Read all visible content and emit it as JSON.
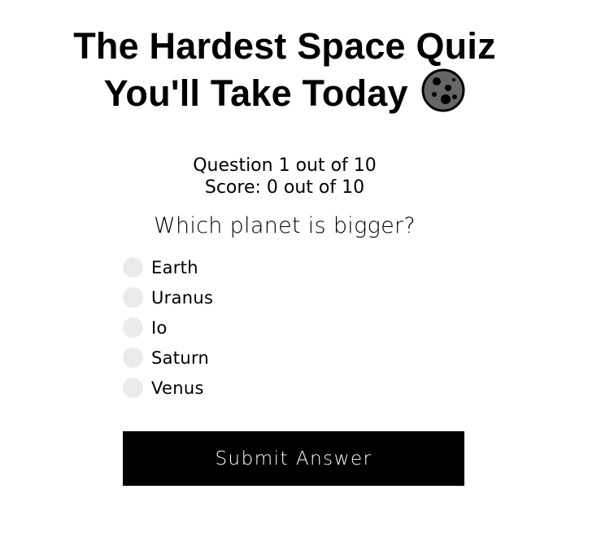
{
  "header": {
    "title_line1": "The Hardest Space Quiz",
    "title_line2": "You'll Take Today",
    "moon_icon": "moon-icon"
  },
  "progress": {
    "question_text": "Question 1 out of 10",
    "score_text": "Score: 0 out of 10"
  },
  "quiz": {
    "question": "Which planet is bigger?",
    "options": [
      {
        "label": "Earth"
      },
      {
        "label": "Uranus"
      },
      {
        "label": "Io"
      },
      {
        "label": "Saturn"
      },
      {
        "label": "Venus"
      }
    ]
  },
  "submit": {
    "label": "Submit Answer"
  },
  "colors": {
    "button_bg": "#000000",
    "button_text": "#ffffff",
    "radio_bg": "#ebebeb"
  }
}
